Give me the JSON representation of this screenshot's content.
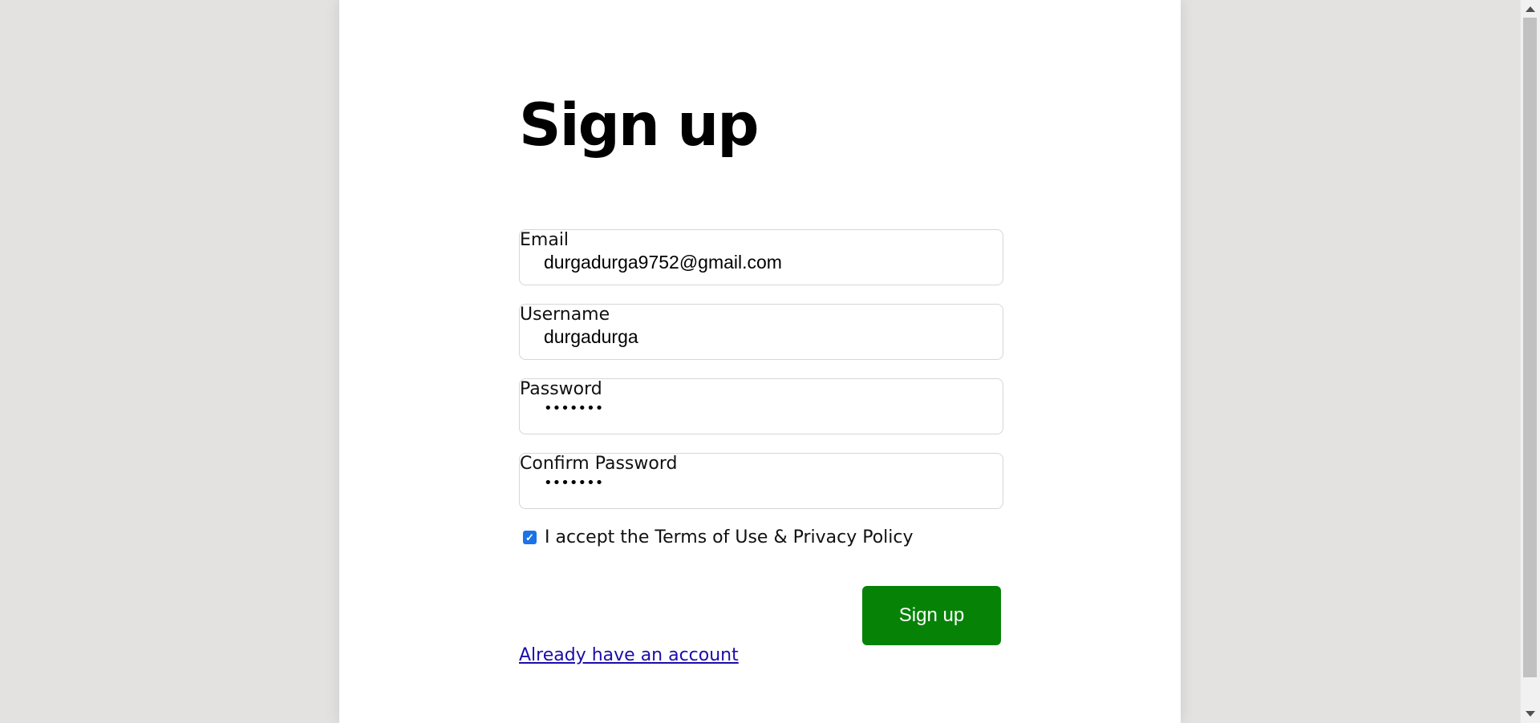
{
  "form": {
    "title": "Sign up",
    "fields": [
      {
        "label": "Email",
        "value": "durgadurga9752@gmail.com"
      },
      {
        "label": "Username",
        "value": "durgadurga"
      },
      {
        "label": "Password",
        "masked_value": "•••••••"
      },
      {
        "label": "Confirm Password",
        "masked_value": "•••••••"
      }
    ],
    "terms": {
      "checked": true,
      "text": "I accept the Terms of Use & Privacy Policy"
    },
    "button_label": "Sign up",
    "account_link": "Already have an account"
  },
  "colors": {
    "background": "#e3e2e0",
    "panel": "#ffffff",
    "button": "#068307",
    "link": "#1a0dab",
    "checkbox": "#1a73e8"
  },
  "icons": {
    "checkbox_mark": "check-icon",
    "scroll_up": "up-arrow-icon",
    "scroll_down": "down-arrow-icon"
  }
}
